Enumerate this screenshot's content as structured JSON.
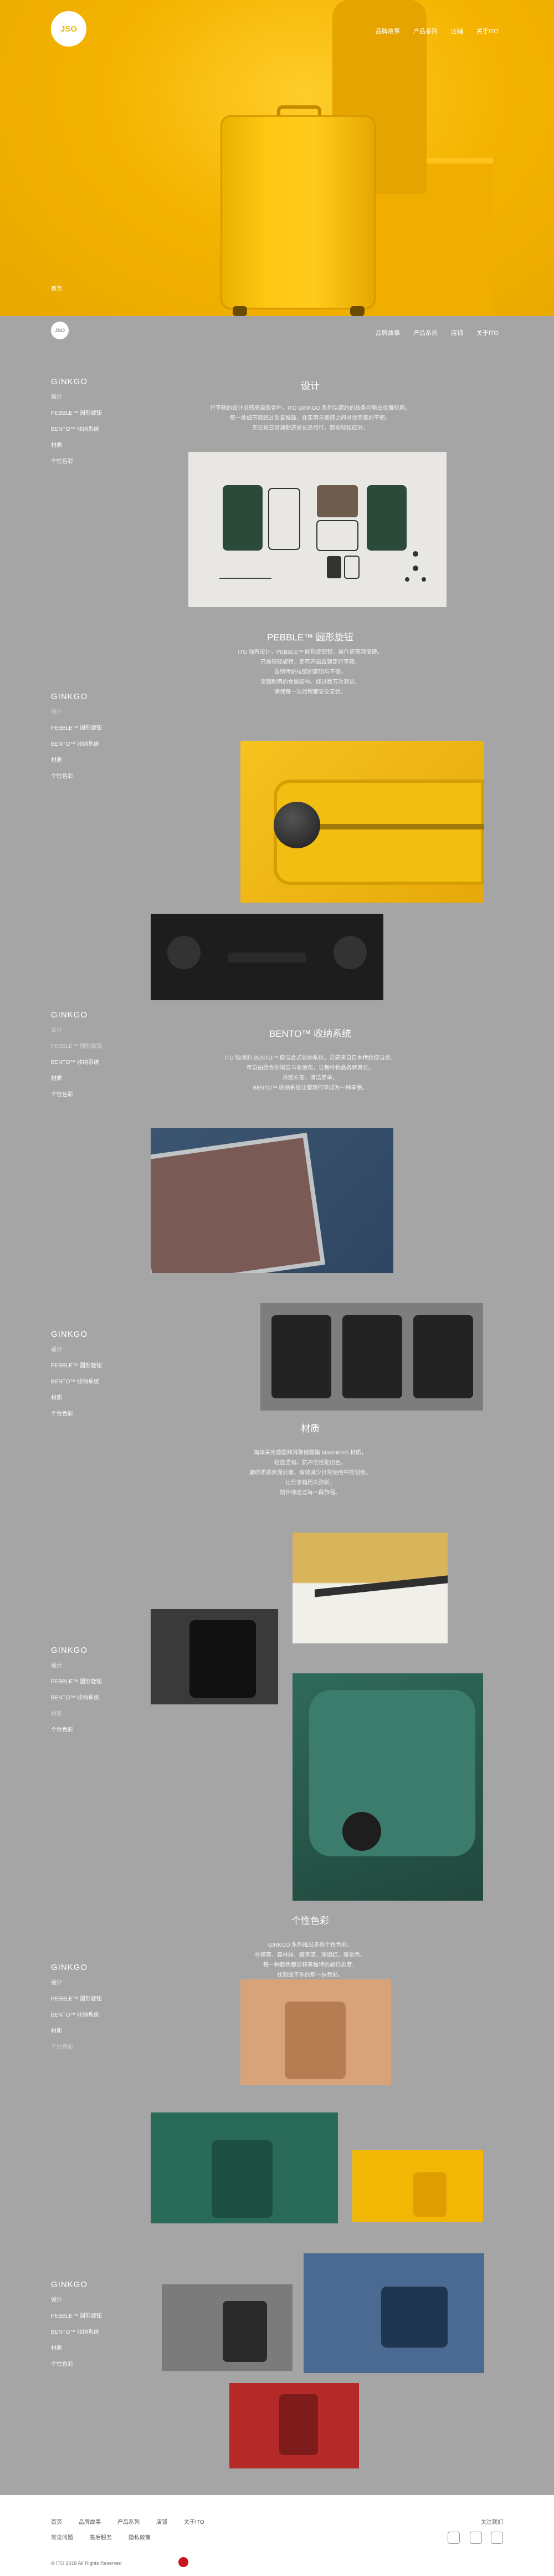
{
  "brand": {
    "logo_text": "JSO"
  },
  "nav": {
    "items": [
      "品牌故事",
      "产品系列",
      "店铺",
      "关于ITO"
    ]
  },
  "hero": {
    "tag": "首页"
  },
  "sidebar": {
    "title": "GINKGO",
    "items": [
      "设计",
      "PEBBLE™ 圆形旋钮",
      "BENTO™ 收纳系统",
      "材质",
      "个性色彩"
    ]
  },
  "sections": {
    "design": {
      "title": "设计",
      "text": [
        "行李箱的设计灵感来自银杏叶，ITO GINKGO 系列以简约的线条勾勒出优雅轮廓。",
        "每一处细节都经过反复推敲，在实用与美感之间寻找完美的平衡。",
        "无论是日常通勤还是长途旅行，都能轻松应对。"
      ]
    },
    "pebble": {
      "title": "PEBBLE™ 圆形旋钮",
      "text": [
        "ITO 独有设计，PEBBLE™ 圆形旋钮锁，操作更直观便捷。",
        "只需轻轻旋转，即可开启或锁定行李箱，",
        "告别传统拉链的繁琐与不便。",
        "坚固耐用的金属结构，经过数万次测试，",
        "确保每一次旅程都安全无忧。"
      ]
    },
    "bento": {
      "title": "BENTO™ 收纳系统",
      "text": [
        "ITO 独创的 BENTO™ 便当盒式收纳系统，灵感来自日本传统便当盒。",
        "可自由组合的隔层与收纳包，让每件物品各就其位。",
        "拆卸方便，清洁简单，",
        "BENTO™ 收纳系统让整理行李成为一种享受。"
      ]
    },
    "material": {
      "title": "材质",
      "text": [
        "箱体采用德国拜耳聚碳酸酯 Makrolon® 材质，",
        "轻盈坚韧，抗冲击性能出色。",
        "磨砂质感表面处理，有效减少日常使用中的划痕，",
        "让行李箱历久弥新，",
        "陪伴你走过每一段旅程。"
      ]
    },
    "color": {
      "title": "个性色彩",
      "text": [
        "GINKGO 系列推出多款个性色彩，",
        "柠檬黄、森林绿、藏青蓝、珊瑚红、暖杏色，",
        "每一种颜色都诠释着独特的旅行态度，",
        "找到属于你的那一抹色彩。"
      ]
    }
  },
  "footer": {
    "links": [
      "首页",
      "品牌故事",
      "产品系列",
      "店铺",
      "关于ITO"
    ],
    "links2": [
      "常见问题",
      "售后服务",
      "隐私政策"
    ],
    "contact": "关注我们",
    "copyright": "© ITO 2018 All Rights Reserved"
  }
}
